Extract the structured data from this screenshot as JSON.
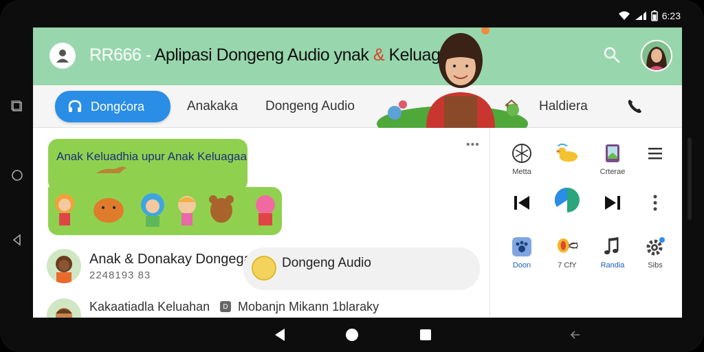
{
  "status_bar": {
    "time": "6:23"
  },
  "app_bar": {
    "title_part1": "RR666 - ",
    "title_part2": "Aplipasi Dongeng Audio ",
    "title_part3": "ynak ",
    "title_amp": "&",
    "title_part4": " Keluagaa"
  },
  "tabs": {
    "active": "Dongćora",
    "tab2": "Anakaka",
    "tab3": "Dongeng Audio",
    "tab4": "Haldiera"
  },
  "banner": {
    "text": "Anak Keluadhia  upur Anak Keluagaa"
  },
  "list": {
    "row1_title": "Anak & Donakay Dongega",
    "row1_sub": "2248193 83",
    "pill_label": "Dongeng Audio",
    "row2_title": "Kakaatiadla  Keluahan",
    "row2_badge": "D",
    "row2_desc": "Mobanjn Mikann 1blaraky"
  },
  "panel": {
    "items": [
      {
        "label": "Metta",
        "icon": "globe-icon"
      },
      {
        "label": "",
        "icon": "duck-icon"
      },
      {
        "label": "Crterae",
        "icon": "mirror-icon"
      },
      {
        "label": "",
        "icon": "menu-icon"
      },
      {
        "label": "",
        "icon": "previous-icon"
      },
      {
        "label": "",
        "icon": "progress-icon"
      },
      {
        "label": "",
        "icon": "next-icon"
      },
      {
        "label": "",
        "icon": "more-vertical-icon"
      },
      {
        "label": "Doon",
        "icon": "paw-icon"
      },
      {
        "label": "7 CfY",
        "icon": "balloon-icon"
      },
      {
        "label": "Randia",
        "icon": "music-icon"
      },
      {
        "label": "Sibs",
        "icon": "settings-icon"
      }
    ]
  },
  "colors": {
    "appbar": "#98d7ad",
    "accent": "#2a8de6",
    "banner": "#8fd14f",
    "title_amp": "#d8432c"
  }
}
